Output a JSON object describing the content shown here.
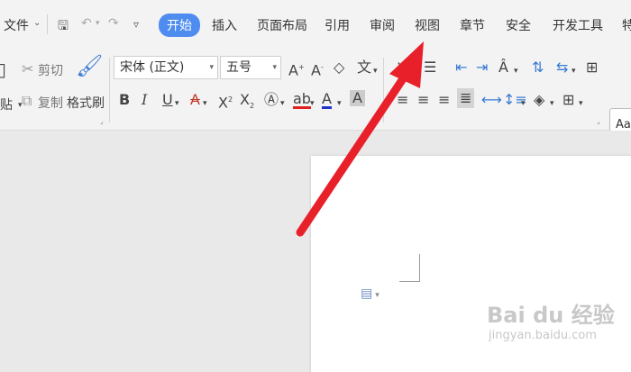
{
  "menubar": {
    "file_label": "文件",
    "tabs": [
      "开始",
      "插入",
      "页面布局",
      "引用",
      "审阅",
      "视图",
      "章节",
      "安全",
      "开发工具",
      "特"
    ],
    "active_tab": "开始"
  },
  "ribbon": {
    "cut_label": "剪切",
    "copy_label": "复制",
    "paste_label": "贴",
    "format_painter_label": "格式刷",
    "font_name": "宋体 (正文)",
    "font_size": "五号",
    "styles_preview": "AaB"
  },
  "annotation": {
    "arrow_color": "#e8202a",
    "target_tab": "视图"
  },
  "watermark": {
    "logo": "Bai du 经验",
    "url": "jingyan.baidu.com"
  },
  "colors": {
    "accent": "#4f8cf0",
    "arrow": "#e8202a"
  }
}
